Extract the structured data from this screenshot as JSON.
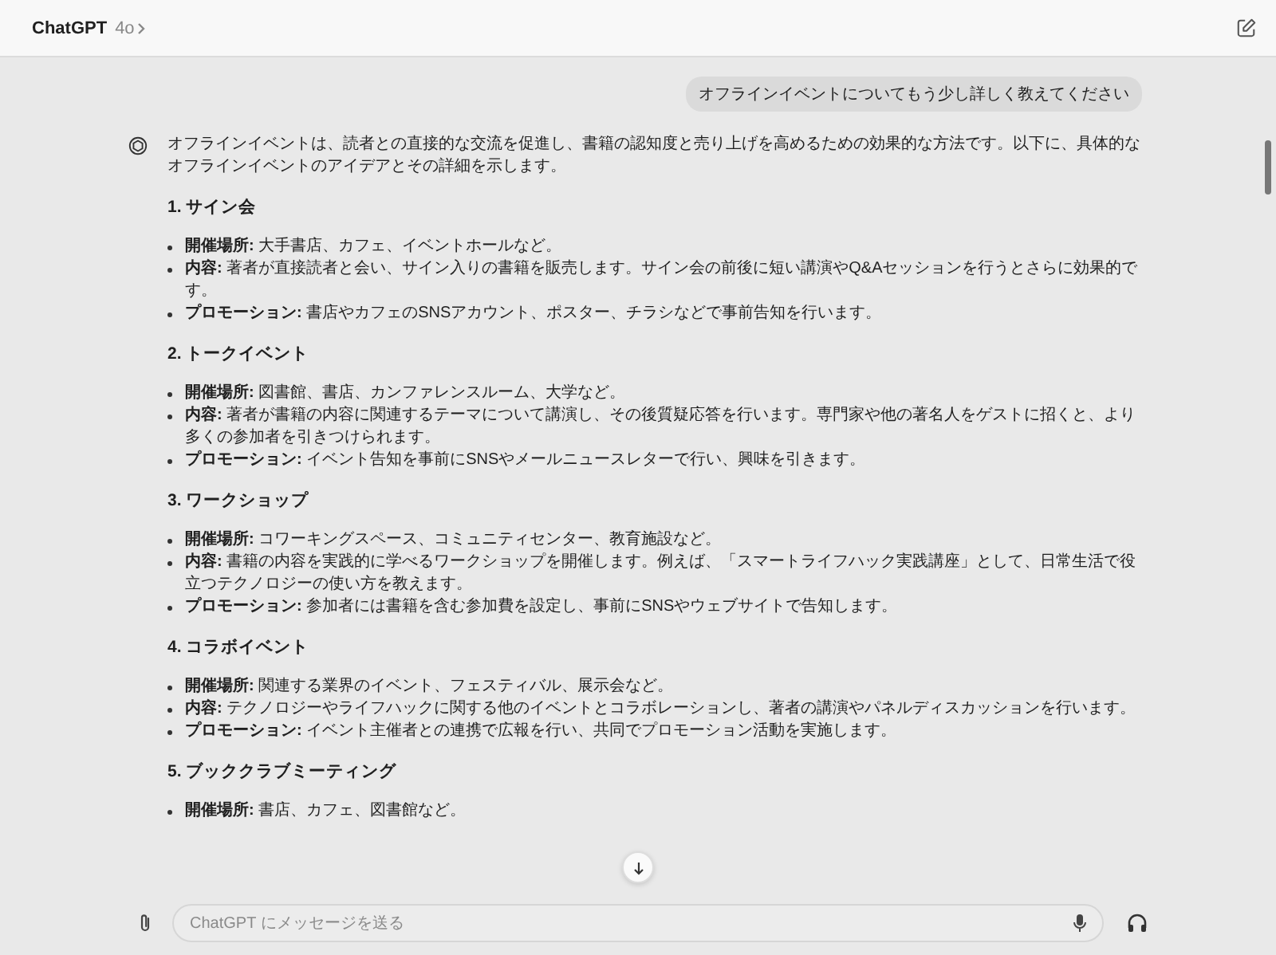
{
  "header": {
    "title": "ChatGPT",
    "model": "4o"
  },
  "user_message": "オフラインイベントについてもう少し詳しく教えてください",
  "assistant": {
    "intro": "オフラインイベントは、読者との直接的な交流を促進し、書籍の認知度と売り上げを高めるための効果的な方法です。以下に、具体的なオフラインイベントのアイデアとその詳細を示します。",
    "sections": [
      {
        "heading": "1. サイン会",
        "items": [
          "**開催場所:** 大手書店、カフェ、イベントホールなど。",
          "**内容:** 著者が直接読者と会い、サイン入りの書籍を販売します。サイン会の前後に短い講演やQ&Aセッションを行うとさらに効果的です。",
          "**プロモーション:** 書店やカフェのSNSアカウント、ポスター、チラシなどで事前告知を行います。"
        ]
      },
      {
        "heading": "2. トークイベント",
        "items": [
          "**開催場所:** 図書館、書店、カンファレンスルーム、大学など。",
          "**内容:** 著者が書籍の内容に関連するテーマについて講演し、その後質疑応答を行います。専門家や他の著名人をゲストに招くと、より多くの参加者を引きつけられます。",
          "**プロモーション:** イベント告知を事前にSNSやメールニュースレターで行い、興味を引きます。"
        ]
      },
      {
        "heading": "3. ワークショップ",
        "items": [
          "**開催場所:** コワーキングスペース、コミュニティセンター、教育施設など。",
          "**内容:** 書籍の内容を実践的に学べるワークショップを開催します。例えば、「スマートライフハック実践講座」として、日常生活で役立つテクノロジーの使い方を教えます。",
          "**プロモーション:** 参加者には書籍を含む参加費を設定し、事前にSNSやウェブサイトで告知します。"
        ]
      },
      {
        "heading": "4. コラボイベント",
        "items": [
          "**開催場所:** 関連する業界のイベント、フェスティバル、展示会など。",
          "**内容:** テクノロジーやライフハックに関する他のイベントとコラボレーションし、著者の講演やパネルディスカッションを行います。",
          "**プロモーション:** イベント主催者との連携で広報を行い、共同でプロモーション活動を実施します。"
        ]
      },
      {
        "heading": "5. ブッククラブミーティング",
        "items": [
          "**開催場所:** 書店、カフェ、図書館など。"
        ]
      }
    ]
  },
  "composer": {
    "placeholder": "ChatGPT にメッセージを送る"
  }
}
